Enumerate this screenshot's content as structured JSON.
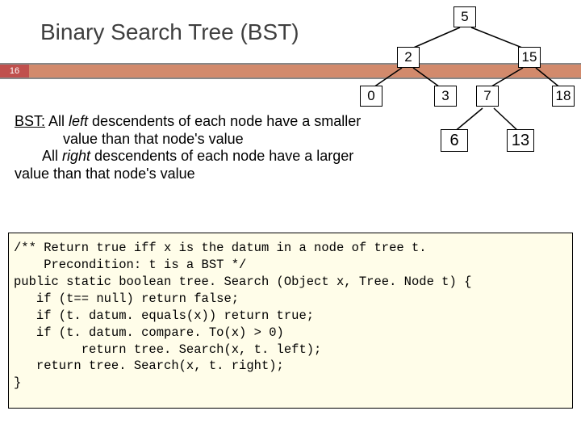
{
  "slide": {
    "title": "Binary Search Tree (BST)",
    "page_number": "16"
  },
  "description": {
    "line1a": "BST:",
    "line1b": " All ",
    "line1c": "left",
    "line1d": " descendents of each node have a smaller",
    "line2": "            value than that node's value",
    "line3a": "       All ",
    "line3b": "right",
    "line3c": " descendents of each node have a larger value than that node's value"
  },
  "code": {
    "l1": "/** Return true iff x is the datum in a node of tree t.",
    "l2": "    Precondition: t is a BST */",
    "l3": "public static boolean tree. Search (Object x, Tree. Node t) {",
    "l4": "   if (t== null) return false;",
    "l5": "   if (t. datum. equals(x)) return true;",
    "l6": "   if (t. datum. compare. To(x) > 0)",
    "l7": "         return tree. Search(x, t. left);",
    "l8": "   return tree. Search(x, t. right);",
    "l9": "}"
  },
  "tree": {
    "n_root": "5",
    "n_2": "2",
    "n_15": "15",
    "n_0": "0",
    "n_3": "3",
    "n_7": "7",
    "n_18": "18",
    "n_6": "6",
    "n_13": "13"
  }
}
